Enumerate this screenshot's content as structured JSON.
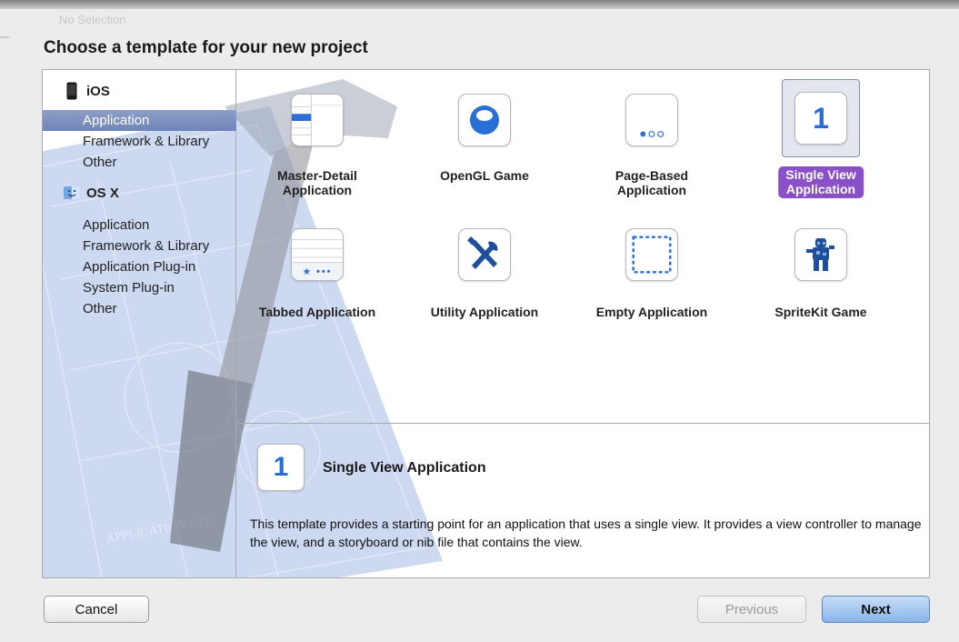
{
  "window": {
    "ghost_title": "No Selection",
    "sheet_title": "Choose a template for your new project"
  },
  "sidebar": {
    "groups": [
      {
        "label": "iOS",
        "icon": "iphone-icon",
        "items": [
          {
            "label": "Application",
            "selected": true
          },
          {
            "label": "Framework & Library",
            "selected": false
          },
          {
            "label": "Other",
            "selected": false
          }
        ]
      },
      {
        "label": "OS X",
        "icon": "finder-icon",
        "items": [
          {
            "label": "Application",
            "selected": false
          },
          {
            "label": "Framework & Library",
            "selected": false
          },
          {
            "label": "Application Plug-in",
            "selected": false
          },
          {
            "label": "System Plug-in",
            "selected": false
          },
          {
            "label": "Other",
            "selected": false
          }
        ]
      }
    ]
  },
  "templates": [
    {
      "label_line1": "Master-Detail",
      "label_line2": "Application",
      "icon": "master-detail-icon",
      "selected": false
    },
    {
      "label_line1": "OpenGL Game",
      "label_line2": "",
      "icon": "opengl-icon",
      "selected": false
    },
    {
      "label_line1": "Page-Based",
      "label_line2": "Application",
      "icon": "page-based-icon",
      "selected": false
    },
    {
      "label_line1": "Single View",
      "label_line2": "Application",
      "icon": "single-view-icon",
      "icon_text": "1",
      "selected": true
    },
    {
      "label_line1": "Tabbed Application",
      "label_line2": "",
      "icon": "tabbed-icon",
      "selected": false
    },
    {
      "label_line1": "Utility Application",
      "label_line2": "",
      "icon": "utility-icon",
      "selected": false
    },
    {
      "label_line1": "Empty Application",
      "label_line2": "",
      "icon": "empty-icon",
      "selected": false
    },
    {
      "label_line1": "SpriteKit Game",
      "label_line2": "",
      "icon": "spritekit-icon",
      "selected": false
    }
  ],
  "description": {
    "icon_text": "1",
    "title": "Single View Application",
    "text": "This template provides a starting point for an application that uses a single view. It provides a view controller to manage the view, and a storyboard or nib file that contains the view."
  },
  "buttons": {
    "cancel": "Cancel",
    "previous": "Previous",
    "next": "Next"
  },
  "colors": {
    "selection_blue": "#7b8fbf",
    "selected_label_purple": "#8b4fc7",
    "accent_blue": "#2a6fd6",
    "next_button": "#a6c8f0"
  }
}
